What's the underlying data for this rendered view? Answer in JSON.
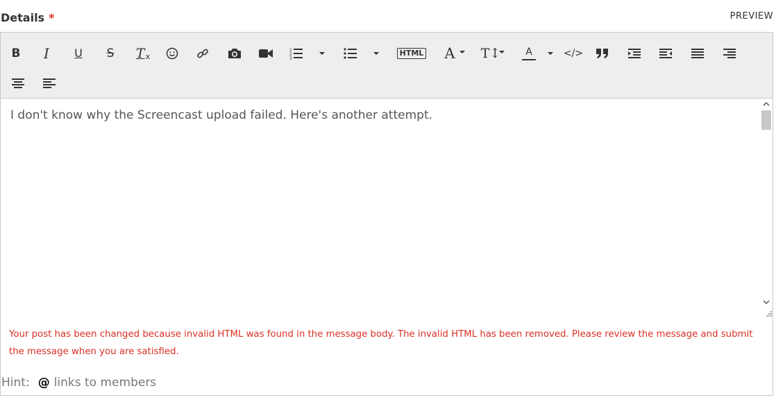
{
  "field": {
    "label": "Details",
    "required_mark": "*",
    "preview_label": "PREVIEW"
  },
  "toolbar": {
    "buttons": [
      {
        "name": "bold",
        "glyph": "B"
      },
      {
        "name": "italic",
        "glyph": "I"
      },
      {
        "name": "underline",
        "glyph": "U"
      },
      {
        "name": "strikethrough",
        "glyph": "S"
      },
      {
        "name": "clear-formatting",
        "glyph": "T"
      },
      {
        "name": "emoji",
        "icon": "emoji-icon"
      },
      {
        "name": "link",
        "icon": "link-icon"
      },
      {
        "name": "insert-photo",
        "icon": "camera-icon"
      },
      {
        "name": "insert-video",
        "icon": "video-icon"
      },
      {
        "name": "numbered-list",
        "icon": "numbered-list-icon"
      },
      {
        "name": "bulleted-list",
        "icon": "bulleted-list-icon"
      },
      {
        "name": "html",
        "glyph": "HTML"
      },
      {
        "name": "font-family",
        "glyph": "A"
      },
      {
        "name": "font-size",
        "glyph": "T↕"
      },
      {
        "name": "font-color",
        "glyph": "A"
      },
      {
        "name": "code",
        "glyph": "</>"
      },
      {
        "name": "blockquote",
        "icon": "quote-icon"
      },
      {
        "name": "indent",
        "icon": "indent-icon"
      },
      {
        "name": "outdent",
        "icon": "outdent-icon"
      },
      {
        "name": "justify",
        "icon": "align-justify-icon"
      },
      {
        "name": "align-right",
        "icon": "align-right-icon"
      },
      {
        "name": "align-center",
        "icon": "align-center-icon"
      },
      {
        "name": "align-left",
        "icon": "align-left-icon"
      }
    ]
  },
  "editor": {
    "content": "I don't know why the Screencast upload failed. Here's another attempt."
  },
  "error_message": "Your post has been changed because invalid HTML was found in the message body. The invalid HTML has been removed. Please review the message and submit the message when you are satisfied.",
  "hint": {
    "prefix": "Hint:",
    "symbol": "@",
    "text": "links to members"
  },
  "colors": {
    "error": "#d93025",
    "toolbar_bg": "#eeeeee",
    "border": "#c8c8c8"
  }
}
